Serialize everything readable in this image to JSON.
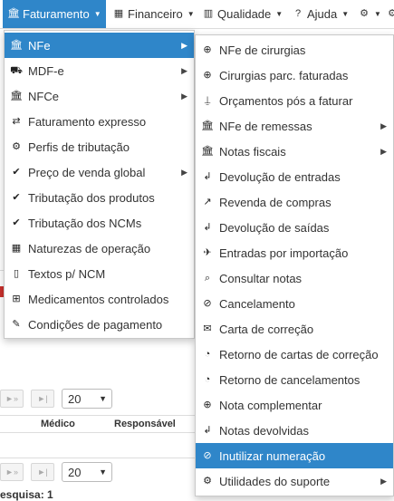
{
  "nav": {
    "faturamento": "Faturamento",
    "financeiro": "Financeiro",
    "qualidade": "Qualidade",
    "ajuda": "Ajuda"
  },
  "background": {
    "page_size": "20",
    "page_size_2": "20",
    "col_medico": "Médico",
    "col_responsavel": "Responsável",
    "search_result": "esquisa: 1"
  },
  "faturamento_menu": [
    {
      "label": "NFe",
      "icon": "bank-icon",
      "submenu": true,
      "active": true
    },
    {
      "label": "MDF-e",
      "icon": "truck-icon",
      "submenu": true
    },
    {
      "label": "NFCe",
      "icon": "bank-icon",
      "submenu": true
    },
    {
      "label": "Faturamento expresso",
      "icon": "exchange-icon"
    },
    {
      "label": "Perfis de tributação",
      "icon": "gear-doc-icon"
    },
    {
      "label": "Preço de venda global",
      "icon": "check-icon",
      "submenu": true
    },
    {
      "label": "Tributação dos produtos",
      "icon": "check-icon"
    },
    {
      "label": "Tributação dos NCMs",
      "icon": "check-icon"
    },
    {
      "label": "Naturezas de operação",
      "icon": "grid-icon"
    },
    {
      "label": "Textos p/ NCM",
      "icon": "clipboard-icon"
    },
    {
      "label": "Medicamentos controlados",
      "icon": "medkit-icon"
    },
    {
      "label": "Condições de pagamento",
      "icon": "pencil-icon"
    }
  ],
  "nfe_menu": [
    {
      "label": "NFe de cirurgias",
      "icon": "plus-circle-icon"
    },
    {
      "label": "Cirurgias parc. faturadas",
      "icon": "plus-circle-icon"
    },
    {
      "label": "Orçamentos pós a faturar",
      "icon": "pin-icon"
    },
    {
      "label": "NFe de remessas",
      "icon": "bank-icon",
      "submenu": true
    },
    {
      "label": "Notas fiscais",
      "icon": "bank-icon",
      "submenu": true
    },
    {
      "label": "Devolução de entradas",
      "icon": "return-icon"
    },
    {
      "label": "Revenda de compras",
      "icon": "arrow-up-right-icon"
    },
    {
      "label": "Devolução de saídas",
      "icon": "return-icon"
    },
    {
      "label": "Entradas por importação",
      "icon": "plane-icon"
    },
    {
      "label": "Consultar notas",
      "icon": "search-icon"
    },
    {
      "label": "Cancelamento",
      "icon": "ban-icon"
    },
    {
      "label": "Carta de correção",
      "icon": "envelope-icon"
    },
    {
      "label": "Retorno de cartas de correção",
      "icon": "rss-icon"
    },
    {
      "label": "Retorno de cancelamentos",
      "icon": "rss-icon"
    },
    {
      "label": "Nota complementar",
      "icon": "plus-circle-icon"
    },
    {
      "label": "Notas devolvidas",
      "icon": "return-icon"
    },
    {
      "label": "Inutilizar numeração",
      "icon": "ban-icon",
      "active": true
    },
    {
      "label": "Utilidades do suporte",
      "icon": "gear-icon",
      "submenu": true
    }
  ]
}
